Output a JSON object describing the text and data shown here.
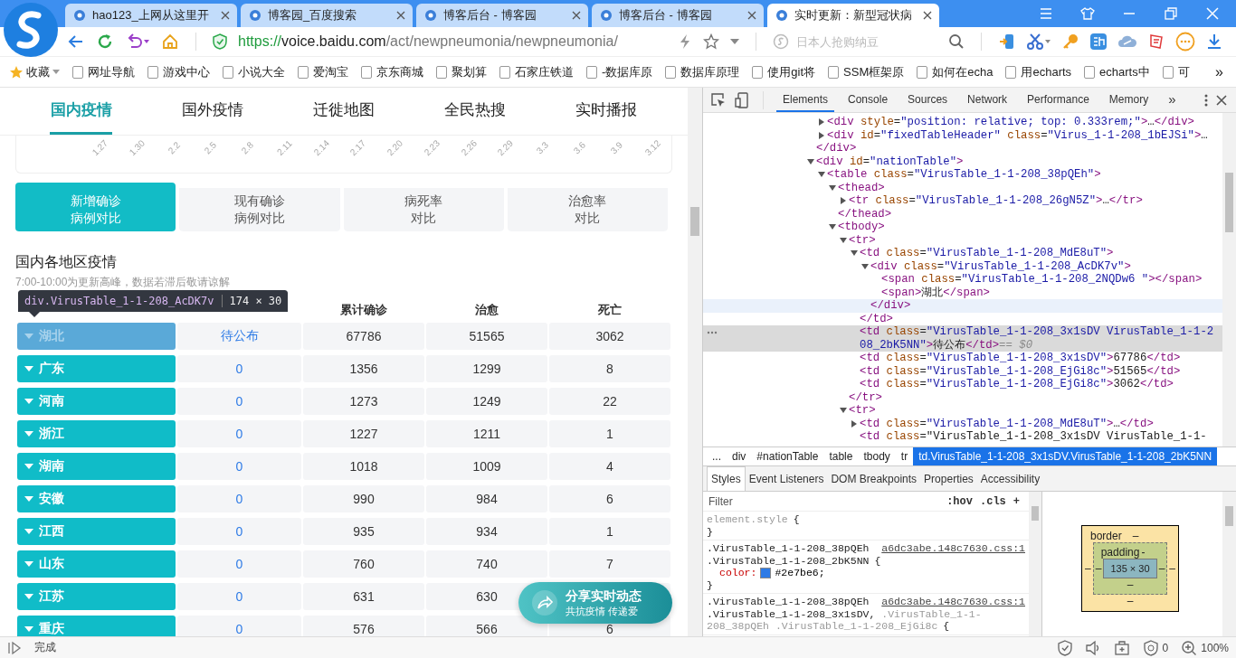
{
  "browser": {
    "tabs": [
      {
        "title": "hao123_上网从这里开",
        "selected": false
      },
      {
        "title": "博客园_百度搜索",
        "selected": false
      },
      {
        "title": "博客后台 - 博客园",
        "selected": false
      },
      {
        "title": "博客后台 - 博客园",
        "selected": false
      },
      {
        "title": "实时更新：新型冠状病",
        "selected": true
      }
    ],
    "url": [
      {
        "text": "https://",
        "kind": "scheme"
      },
      {
        "text": "voice.baidu.com",
        "kind": "host"
      },
      {
        "text": "/act/newpneumonia/newpneumonia/",
        "kind": "path"
      }
    ],
    "search": {
      "placeholder": "日本人抢购纳豆"
    },
    "bookmarks": [
      "收藏",
      "网址导航",
      "游戏中心",
      "小说大全",
      "爱淘宝",
      "京东商城",
      "聚划算",
      "石家庄铁道",
      "-数据库原",
      "数据库原理",
      "使用git将",
      "SSM框架原",
      "如何在echa",
      "用echarts",
      "echarts中",
      "可"
    ],
    "bookmarks_more": "»"
  },
  "page": {
    "nav": [
      {
        "label": "国内疫情",
        "selected": true
      },
      {
        "label": "国外疫情",
        "selected": false
      },
      {
        "label": "迁徙地图",
        "selected": false
      },
      {
        "label": "全民热搜",
        "selected": false
      },
      {
        "label": "实时播报",
        "selected": false
      }
    ],
    "chart_axis_labels": [
      "1.27",
      "1.30",
      "2.2",
      "2.5",
      "2.8",
      "2.11",
      "2.14",
      "2.17",
      "2.20",
      "2.23",
      "2.26",
      "2.29",
      "3.3",
      "3.6",
      "3.9",
      "3.12"
    ],
    "compare_tabs": [
      {
        "lines": [
          "新增确诊",
          "病例对比"
        ],
        "selected": true
      },
      {
        "lines": [
          "现有确诊",
          "病例对比"
        ],
        "selected": false
      },
      {
        "lines": [
          "病死率",
          "对比"
        ],
        "selected": false
      },
      {
        "lines": [
          "治愈率",
          "对比"
        ],
        "selected": false
      }
    ],
    "section_title": "国内各地区疫情",
    "section_note": "7:00-10:00为更新高峰，数据若滞后敬请谅解",
    "inspect_tooltip": {
      "selector": "div.VirusTable_1-1-208_AcDK7v",
      "size": "174 × 30"
    },
    "table": {
      "columns": [
        "累计确诊",
        "治愈",
        "死亡"
      ],
      "rows": [
        {
          "region": "湖北",
          "new": "待公布",
          "total": "67786",
          "cured": "51565",
          "deaths": "3062",
          "highlighted": true
        },
        {
          "region": "广东",
          "new": "0",
          "total": "1356",
          "cured": "1299",
          "deaths": "8",
          "highlighted": false
        },
        {
          "region": "河南",
          "new": "0",
          "total": "1273",
          "cured": "1249",
          "deaths": "22",
          "highlighted": false
        },
        {
          "region": "浙江",
          "new": "0",
          "total": "1227",
          "cured": "1211",
          "deaths": "1",
          "highlighted": false
        },
        {
          "region": "湖南",
          "new": "0",
          "total": "1018",
          "cured": "1009",
          "deaths": "4",
          "highlighted": false
        },
        {
          "region": "安徽",
          "new": "0",
          "total": "990",
          "cured": "984",
          "deaths": "6",
          "highlighted": false
        },
        {
          "region": "江西",
          "new": "0",
          "total": "935",
          "cured": "934",
          "deaths": "1",
          "highlighted": false
        },
        {
          "region": "山东",
          "new": "0",
          "total": "760",
          "cured": "740",
          "deaths": "7",
          "highlighted": false
        },
        {
          "region": "江苏",
          "new": "0",
          "total": "631",
          "cured": "630",
          "highlighted": false
        },
        {
          "region": "重庆",
          "new": "0",
          "total": "576",
          "cured": "566",
          "deaths": "6",
          "highlighted": false
        }
      ]
    },
    "share_button": {
      "title": "分享实时动态",
      "subtitle": "共抗疫情 传递爱"
    }
  },
  "devtools": {
    "tabs": [
      {
        "label": "Elements",
        "selected": true
      },
      {
        "label": "Console",
        "selected": false
      },
      {
        "label": "Sources",
        "selected": false
      },
      {
        "label": "Network",
        "selected": false
      },
      {
        "label": "Performance",
        "selected": false
      },
      {
        "label": "Memory",
        "selected": false
      }
    ],
    "more_tabs": "»",
    "dom_tree": [
      {
        "close": "</div>",
        "children": [
          {
            "open": "<div style=\"position: relative; top: 0.333rem;\">…</div>",
            "expanded": false,
            "selected": false
          },
          {
            "open": "<div id=\"fixedTableHeader\" class=\"Virus_1-1-208_1bEJSi\">…",
            "expanded": false,
            "selected": false
          }
        ]
      },
      {
        "open": "<div id=\"nationTable\">",
        "expanded": true,
        "selected": false,
        "children": [
          {
            "open": "<table class=\"VirusTable_1-1-208_38pQEh\">",
            "expanded": true,
            "selected": false,
            "children": [
              {
                "open": "<thead>",
                "close": "</thead>",
                "expanded": true,
                "selected": false,
                "children": [
                  {
                    "open": "<tr class=\"VirusTable_1-1-208_26gN5Z\">…</tr>",
                    "expanded": false,
                    "selected": false
                  }
                ]
              },
              {
                "open": "<tbody>",
                "expanded": true,
                "selected": false,
                "children": [
                  {
                    "open": "<tr>",
                    "close": "</tr>",
                    "expanded": true,
                    "selected": false,
                    "children": [
                      {
                        "open": "<td class=\"VirusTable_1-1-208_MdE8uT\">",
                        "close": "</td>",
                        "expanded": true,
                        "selected": false,
                        "children": [
                          {
                            "open": "<div class=\"VirusTable_1-1-208_AcDK7v\">",
                            "close": "</div>",
                            "expanded": true,
                            "selected": false,
                            "hovered": true,
                            "children": [
                              {
                                "open": "<span class=\"VirusTable_1-1-208_2NQDw6 \"></span>",
                                "selected": false
                              },
                              {
                                "open": "<span>湖北</span>",
                                "selected": false
                              }
                            ]
                          }
                        ]
                      },
                      {
                        "open": "<td class=\"VirusTable_1-1-208_3x1sDV VirusTable_1-1-208_2bK5NN\">待公布</td>",
                        "ref": "== $0",
                        "selected": true
                      },
                      {
                        "open": "<td class=\"VirusTable_1-1-208_3x1sDV\">67786</td>",
                        "selected": false
                      },
                      {
                        "open": "<td class=\"VirusTable_1-1-208_EjGi8c\">51565</td>",
                        "selected": false
                      },
                      {
                        "open": "<td class=\"VirusTable_1-1-208_EjGi8c\">3062</td>",
                        "selected": false
                      }
                    ]
                  },
                  {
                    "open": "<tr>",
                    "expanded": true,
                    "selected": false,
                    "children": [
                      {
                        "open": "<td class=\"VirusTable_1-1-208_MdE8uT\">…</td>",
                        "expanded": false,
                        "selected": false
                      },
                      {
                        "open": "<td class=\"VirusTable_1-1-208_3x1sDV VirusTable_1-1-",
                        "selected": false
                      }
                    ]
                  }
                ]
              }
            ]
          }
        ]
      }
    ],
    "breadcrumb": [
      {
        "label": "...",
        "selected": false
      },
      {
        "label": "div",
        "selected": false
      },
      {
        "label": "#nationTable",
        "selected": false
      },
      {
        "label": "table",
        "selected": false
      },
      {
        "label": "tbody",
        "selected": false
      },
      {
        "label": "tr",
        "selected": false
      },
      {
        "label": "td.VirusTable_1-1-208_3x1sDV.VirusTable_1-1-208_2bK5NN",
        "selected": true
      }
    ],
    "styles_tabs": [
      {
        "label": "Styles",
        "selected": true
      },
      {
        "label": "Event Listeners",
        "selected": false
      },
      {
        "label": "DOM Breakpoints",
        "selected": false
      },
      {
        "label": "Properties",
        "selected": false
      },
      {
        "label": "Accessibility",
        "selected": false
      }
    ],
    "filter": {
      "placeholder": "Filter"
    },
    "filter_buttons": [
      ":hov",
      ".cls",
      "+"
    ],
    "rules": [
      {
        "selector": [
          [
            {
              "text": "element.style",
              "matched": false
            }
          ]
        ],
        "open": "{",
        "close": "}"
      },
      {
        "selector": [
          [
            {
              "text": ".VirusTable_1-1-208_38pQEh",
              "matched": true
            }
          ],
          [
            {
              "text": ".VirusTable_1-1-208_2bK5NN",
              "matched": true
            }
          ]
        ],
        "source": "a6dc3abe.148c7630.css:1",
        "open": "{",
        "declarations": [
          {
            "property": "color:",
            "value": "#2e7be6;",
            "color": "#2e7be6"
          }
        ],
        "close": "}"
      },
      {
        "selector": [
          [
            {
              "text": ".VirusTable_1-1-208_38pQEh",
              "matched": true
            }
          ],
          [
            {
              "text": ".VirusTable_1-1-208_3x1sDV,",
              "matched": true
            },
            {
              "text": " .VirusTable_1-1-",
              "matched": false
            }
          ],
          [
            {
              "text": "208_38pQEh .VirusTable_1-1-208_EjGi8c",
              "matched": false
            }
          ]
        ],
        "source": "a6dc3abe.148c7630.css:1",
        "open": "{"
      }
    ],
    "box_model": {
      "border_label": "border",
      "padding_label": "padding",
      "content": "135 × 30",
      "border": [
        "–",
        "–",
        "–",
        "–"
      ],
      "padding": [
        "-",
        "–",
        "–",
        "–"
      ]
    }
  },
  "status_bar": {
    "text": "完成",
    "adblock_count": "0",
    "zoom": "100%"
  }
}
